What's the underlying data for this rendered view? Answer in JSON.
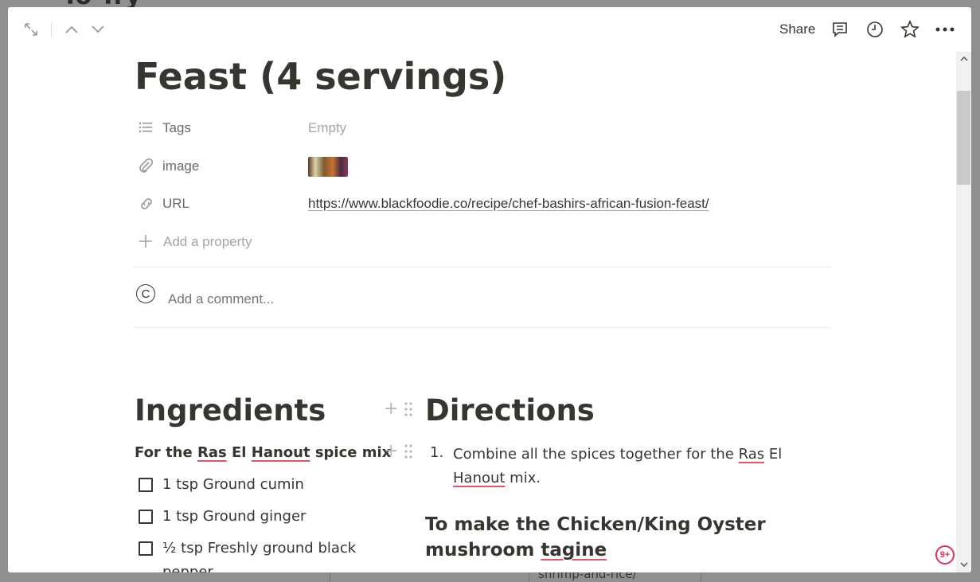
{
  "background": {
    "peek_title": "To Try",
    "peek_bottom_text": "shrimp-and-rice/"
  },
  "topbar": {
    "share_label": "Share",
    "icons": [
      "expand-icon",
      "chevron-up-icon",
      "chevron-down-icon",
      "comment-icon",
      "clock-icon",
      "star-icon",
      "more-icon"
    ]
  },
  "page": {
    "title": "Feast (4 servings)"
  },
  "properties": [
    {
      "name": "Tags",
      "value": "Empty",
      "icon": "list-icon"
    },
    {
      "name": "image",
      "value": "",
      "icon": "paperclip-icon"
    },
    {
      "name": "URL",
      "value": "https://www.blackfoodie.co/recipe/chef-bashirs-african-fusion-feast/",
      "icon": "link-icon"
    }
  ],
  "add_property_label": "Add a property",
  "comment": {
    "avatar_letter": "C",
    "placeholder": "Add a comment..."
  },
  "ingredients": {
    "heading": "Ingredients",
    "subheading_parts": [
      "For the ",
      "Ras",
      " ",
      "El",
      " ",
      "Hanout",
      " spice mix"
    ],
    "items": [
      "1 tsp Ground cumin",
      "1 tsp Ground ginger",
      "½ tsp Freshly ground black pepper"
    ]
  },
  "directions": {
    "heading": "Directions",
    "step_number": "1.",
    "step_parts": [
      "Combine all the spices together for the ",
      "Ras",
      " El ",
      "Hanout",
      " mix."
    ],
    "subheading_parts": [
      "To make the Chicken/King Oyster mushroom ",
      "tagine"
    ]
  },
  "notification_badge": "9+",
  "colors": {
    "text": "#37352f",
    "muted": "#a5a4a0",
    "spellcheck": "#e0566a",
    "badge": "#e0305a"
  }
}
